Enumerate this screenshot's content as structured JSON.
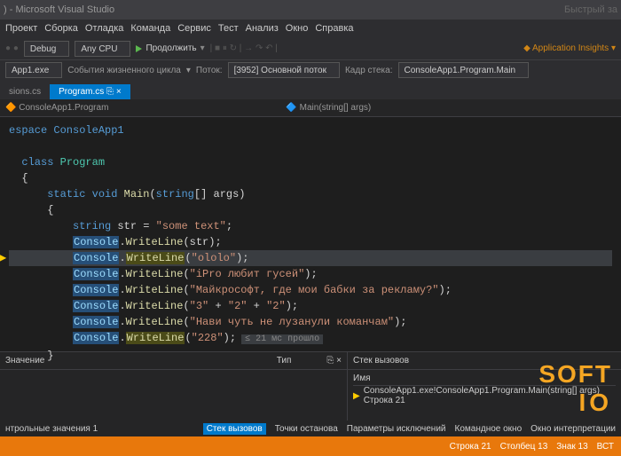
{
  "title": ") - Microsoft Visual Studio",
  "menu": [
    "Проект",
    "Сборка",
    "Отладка",
    "Команда",
    "Сервис",
    "Тест",
    "Анализ",
    "Окно",
    "Справка"
  ],
  "toolbar": {
    "config": "Debug",
    "platform": "Any CPU",
    "run": "Продолжить",
    "appinsights": "Application Insights"
  },
  "toolbar2": {
    "process": "App1.exe",
    "lifecycle": "События жизненного цикла",
    "thread_label": "Поток:",
    "thread": "[3952] Основной поток",
    "stack_label": "Кадр стека:",
    "stack": "ConsoleApp1.Program.Main"
  },
  "tabs": {
    "left": "sions.cs",
    "active": "Program.cs"
  },
  "context": {
    "left": "ConsoleApp1.Program",
    "right": "Main(string[] args)"
  },
  "code": {
    "ns": "espace ConsoleApp1",
    "cls": "class",
    "clsname": "Program",
    "sig_static": "static",
    "sig_void": "void",
    "sig_main": "Main",
    "sig_string": "string",
    "sig_args": "[] args)",
    "l1_kw": "string",
    "l1_var": " str = ",
    "l1_str": "\"some text\"",
    "console": "Console",
    "wl": "WriteLine",
    "arg1": "(str);",
    "arg2": "\"ololo\"",
    "arg3": "\"iPro любит гусей\"",
    "arg4": "\"Майкрософт, где мои бабки за рекламу?\"",
    "arg5a": "\"3\"",
    "arg5b": "\"2\"",
    "arg5c": "\"2\"",
    "arg6": "\"Нави чуть не лузанули команчам\"",
    "arg7": "\"228\"",
    "hint": "≤ 21 мс прошло"
  },
  "panels": {
    "left": {
      "col1": "Значение",
      "col2": "Тип",
      "tab": "нтрольные значения 1"
    },
    "right": {
      "title": "Стек вызовов",
      "col": "Имя",
      "row": "ConsoleApp1.exe!ConsoleApp1.Program.Main(string[] args) Строка 21",
      "tabs": [
        "Стек вызовов",
        "Точки останова",
        "Параметры исключений",
        "Командное окно",
        "Окно интерпретации"
      ]
    }
  },
  "status": {
    "left": "",
    "line": "Строка 21",
    "col": "Столбец 13",
    "char": "Знак 13",
    "ins": "ВСТ"
  },
  "search_hint": "Быстрый за",
  "watermark1": "SOFT",
  "watermark2": "IO"
}
